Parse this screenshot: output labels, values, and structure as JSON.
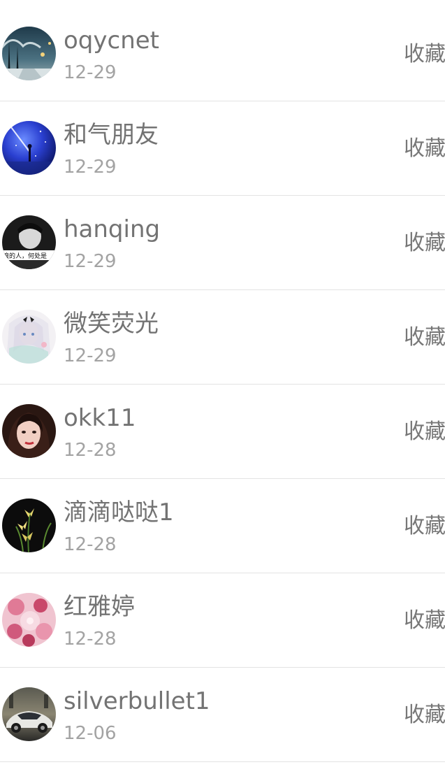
{
  "list": {
    "items": [
      {
        "name": "oqycnet",
        "date": "12-29",
        "action": "收藏",
        "avatar": "snowy-street-avatar"
      },
      {
        "name": "和气朋友",
        "date": "12-29",
        "action": "收藏",
        "avatar": "starry-night-avatar"
      },
      {
        "name": "hanqing",
        "date": "12-29",
        "action": "收藏",
        "avatar": "bw-portrait-avatar",
        "avatar_caption": "浪的人，何处是"
      },
      {
        "name": "微笑荧光",
        "date": "12-29",
        "action": "收藏",
        "avatar": "anime-girl-avatar"
      },
      {
        "name": "okk11",
        "date": "12-28",
        "action": "收藏",
        "avatar": "portrait-avatar"
      },
      {
        "name": "滴滴哒哒1",
        "date": "12-28",
        "action": "收藏",
        "avatar": "orchid-avatar"
      },
      {
        "name": "红雅婷",
        "date": "12-28",
        "action": "收藏",
        "avatar": "pink-floral-avatar"
      },
      {
        "name": "silverbullet1",
        "date": "12-06",
        "action": "收藏",
        "avatar": "car-avatar"
      }
    ]
  }
}
